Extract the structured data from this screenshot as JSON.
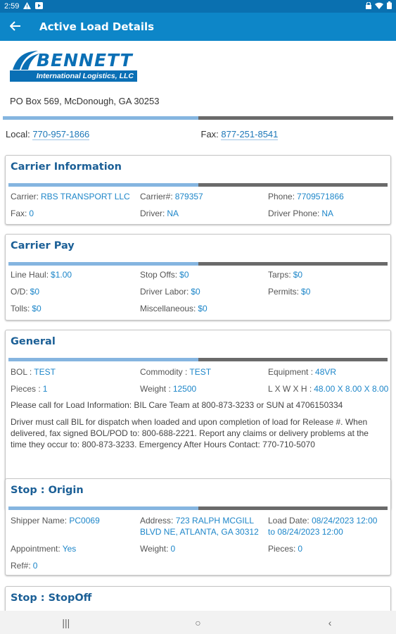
{
  "status": {
    "time": "2:59",
    "icons": [
      "warning-icon",
      "play-icon",
      "lock-icon",
      "wifi-icon",
      "battery-icon"
    ]
  },
  "appbar": {
    "back_icon": "arrow-back-icon",
    "title": "Active Load Details"
  },
  "company": {
    "logo_name": "BENNETT",
    "logo_tagline": "International Logistics, LLC",
    "address": "PO Box 569, McDonough, GA 30253",
    "local_label": "Local:",
    "local_phone": "770-957-1866",
    "fax_label": "Fax:",
    "fax_number": "877-251-8541"
  },
  "carrier_info": {
    "title": "Carrier Information",
    "carrier_label": "Carrier:",
    "carrier_value": "RBS TRANSPORT LLC",
    "carrier_num_label": "Carrier#:",
    "carrier_num_value": "879357",
    "phone_label": "Phone:",
    "phone_value": "7709571866",
    "fax_label": "Fax:",
    "fax_value": "0",
    "driver_label": "Driver:",
    "driver_value": "NA",
    "driver_phone_label": "Driver Phone:",
    "driver_phone_value": "NA"
  },
  "carrier_pay": {
    "title": "Carrier Pay",
    "line_haul_label": "Line Haul:",
    "line_haul_value": "$1.00",
    "stop_offs_label": "Stop Offs:",
    "stop_offs_value": "$0",
    "tarps_label": "Tarps:",
    "tarps_value": "$0",
    "od_label": "O/D:",
    "od_value": "$0",
    "driver_labor_label": "Driver Labor:",
    "driver_labor_value": "$0",
    "permits_label": "Permits:",
    "permits_value": "$0",
    "tolls_label": "Tolls:",
    "tolls_value": "$0",
    "misc_label": "Miscellaneous:",
    "misc_value": "$0"
  },
  "general": {
    "title": "General",
    "bol_label": "BOL :",
    "bol_value": "TEST",
    "commodity_label": "Commodity :",
    "commodity_value": "TEST",
    "equipment_label": "Equipment :",
    "equipment_value": "48VR",
    "pieces_label": "Pieces :",
    "pieces_value": "1",
    "weight_label": "Weight :",
    "weight_value": "12500",
    "dims_label": "L X W X H :",
    "dims_value": "48.00 X 8.00 X 8.00",
    "note1": "Please call for Load Information: BIL Care Team at 800-873-3233 or SUN at 4706150334",
    "note2": "Driver must call BIL for dispatch when loaded and upon completion of load for Release #. When delivered, fax signed BOL/POD to: 800-688-2221. Report any claims or delivery problems at the time they occur to: 800-873-3233. Emergency After Hours Contact: 770-710-5070"
  },
  "stop_origin": {
    "title": "Stop : Origin",
    "shipper_label": "Shipper Name:",
    "shipper_value": "PC0069",
    "address_label": "Address:",
    "address_value": "723 RALPH MCGILL BLVD NE, ATLANTA, GA 30312",
    "load_date_label": "Load Date:",
    "load_date_value": "08/24/2023 12:00 to 08/24/2023 12:00",
    "appointment_label": "Appointment:",
    "appointment_value": "Yes",
    "weight_label": "Weight:",
    "weight_value": "0",
    "pieces_label": "Pieces:",
    "pieces_value": "0",
    "ref_label": "Ref#:",
    "ref_value": "0"
  },
  "stop_stopoff": {
    "title": "Stop : StopOff"
  },
  "navbar": {
    "recent": "|||",
    "home": "○",
    "back": "‹"
  }
}
